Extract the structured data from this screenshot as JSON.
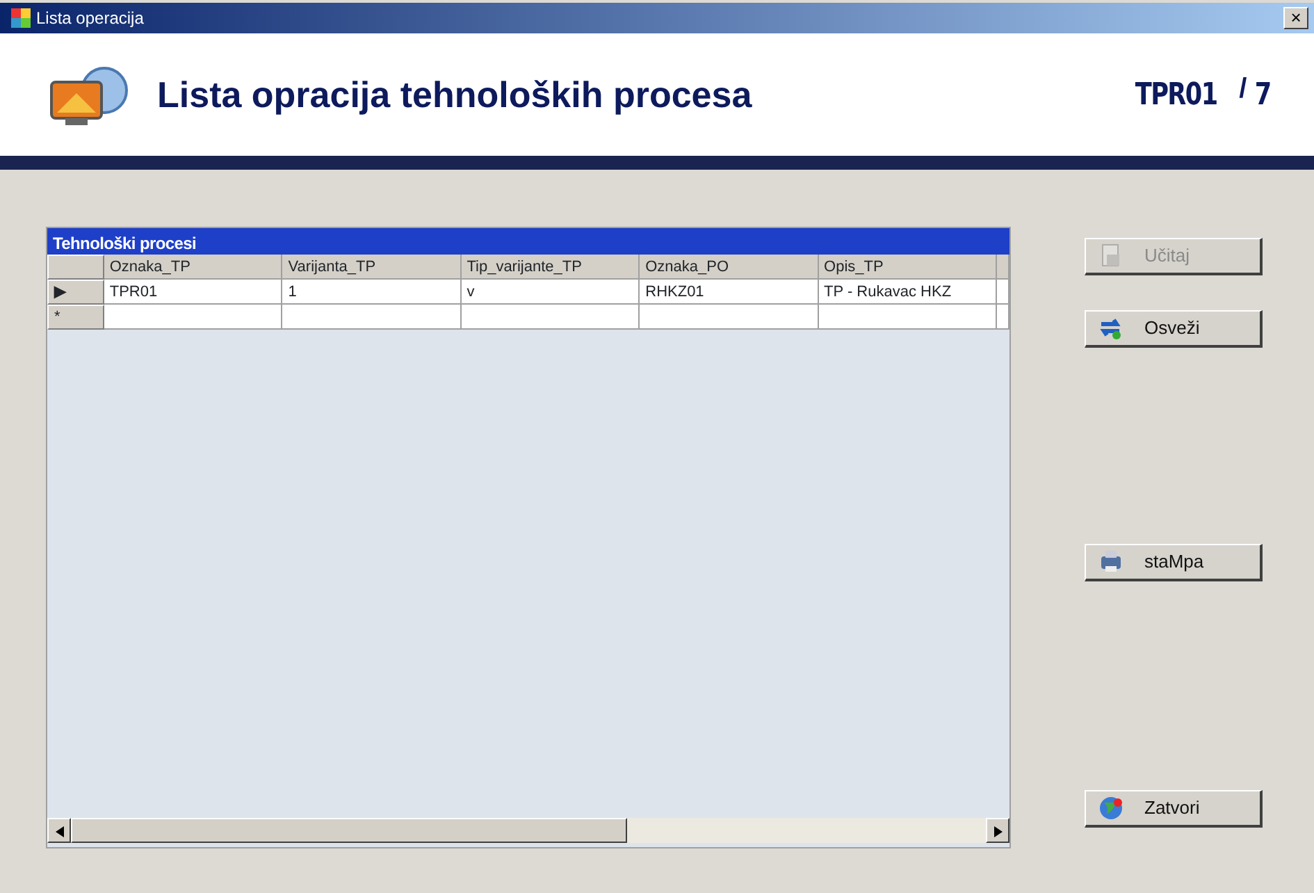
{
  "window": {
    "title": "Lista operacija",
    "close": "×"
  },
  "header": {
    "title": "Lista opracija tehnoloških procesa",
    "code": "TPR01",
    "separator": "/",
    "number": "7"
  },
  "grid": {
    "caption": "Tehnološki procesi",
    "columns": [
      "Oznaka_TP",
      "Varijanta_TP",
      "Tip_varijante_TP",
      "Oznaka_PO",
      "Opis_TP"
    ],
    "rows": [
      {
        "marker": "▶",
        "selected": true,
        "cells": [
          "TPR01",
          "1",
          "v",
          "RHKZ01",
          "TP - Rukavac HKZ"
        ]
      },
      {
        "marker": "*",
        "selected": false,
        "cells": [
          "",
          "",
          "",
          "",
          ""
        ]
      }
    ]
  },
  "buttons": [
    {
      "label": "Učitaj",
      "kind": "load",
      "disabled": true
    },
    {
      "label": "Osveži",
      "kind": "refresh",
      "disabled": false
    },
    {
      "label": "staMpa",
      "kind": "print",
      "disabled": false
    },
    {
      "label": "Zatvori",
      "kind": "close",
      "disabled": false
    }
  ]
}
